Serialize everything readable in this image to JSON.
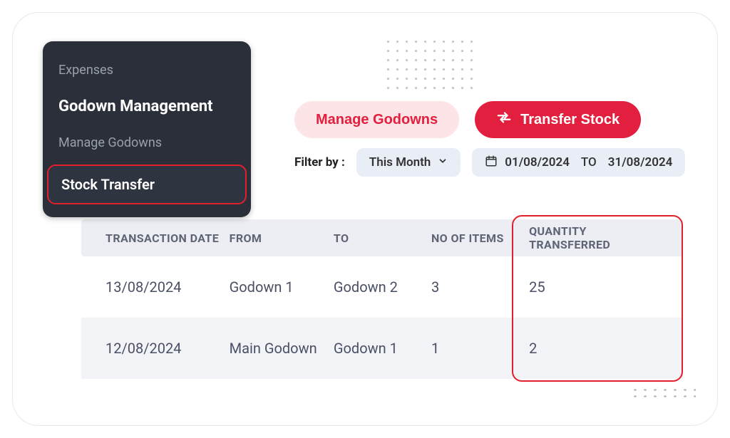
{
  "sidebar": {
    "items": [
      {
        "label": "Expenses",
        "kind": "muted"
      },
      {
        "label": "Godown Management",
        "kind": "section"
      },
      {
        "label": "Manage Godowns",
        "kind": "muted"
      },
      {
        "label": "Stock Transfer",
        "kind": "active"
      }
    ]
  },
  "toolbar": {
    "manage_label": "Manage Godowns",
    "transfer_label": "Transfer Stock"
  },
  "filters": {
    "label": "Filter by :",
    "period": "This Month",
    "date_from": "01/08/2024",
    "date_sep": "TO",
    "date_to": "31/08/2024"
  },
  "table": {
    "headers": {
      "date": "TRANSACTION DATE",
      "from": "FROM",
      "to": "TO",
      "items": "NO OF ITEMS",
      "qty": "QUANTITY TRANSFERRED"
    },
    "rows": [
      {
        "date": "13/08/2024",
        "from": "Godown 1",
        "to": "Godown 2",
        "items": "3",
        "qty": "25"
      },
      {
        "date": "12/08/2024",
        "from": "Main Godown",
        "to": "Godown 1",
        "items": "1",
        "qty": "2"
      }
    ]
  }
}
